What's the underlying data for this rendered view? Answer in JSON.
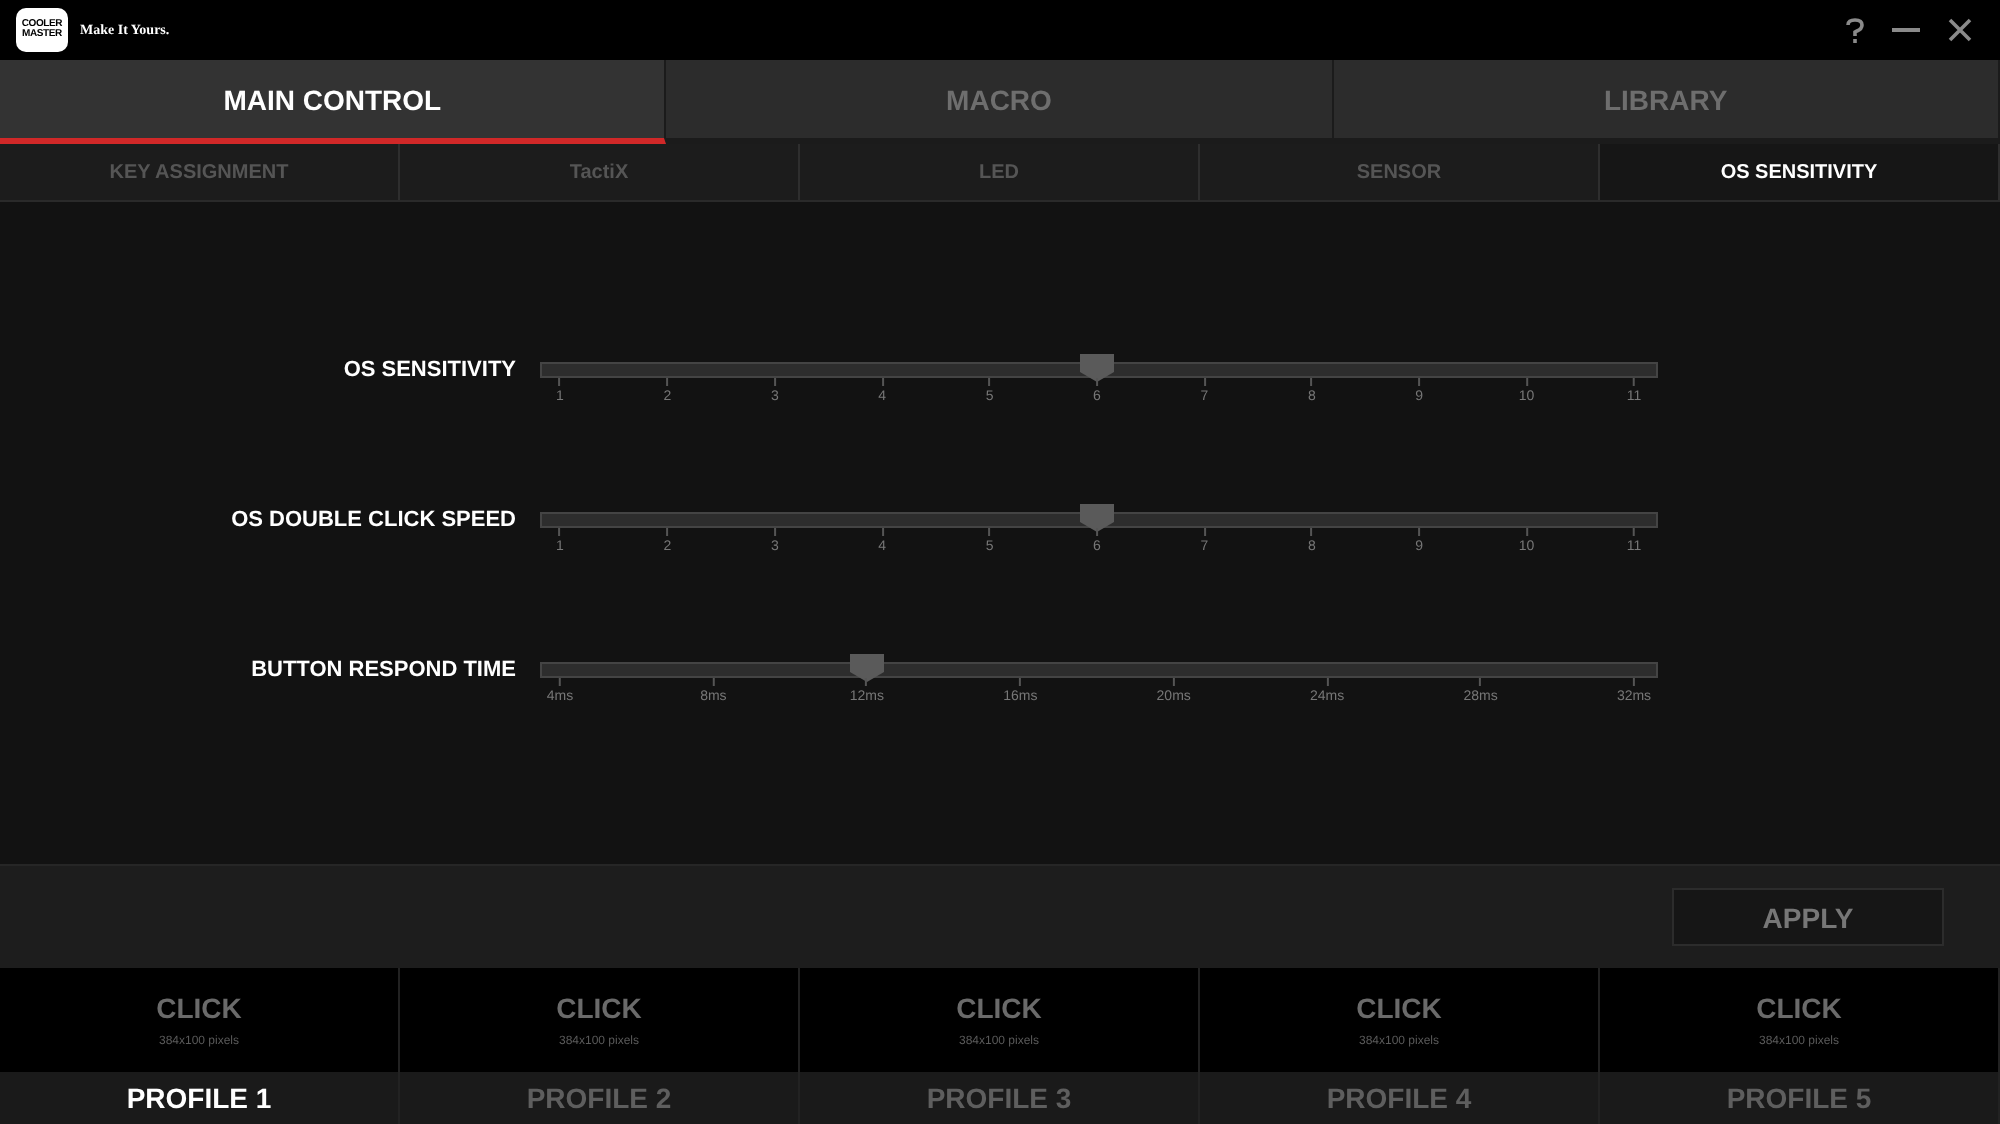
{
  "logo": {
    "lines": [
      "COOLER",
      "MASTER"
    ]
  },
  "tagline": "Make It Yours.",
  "main_tabs": [
    {
      "label": "MAIN CONTROL",
      "selected": true
    },
    {
      "label": "MACRO",
      "selected": false
    },
    {
      "label": "LIBRARY",
      "selected": false
    }
  ],
  "sub_tabs": [
    {
      "label": "KEY ASSIGNMENT",
      "selected": false
    },
    {
      "label": "TactiX",
      "selected": false
    },
    {
      "label": "LED",
      "selected": false
    },
    {
      "label": "SENSOR",
      "selected": false
    },
    {
      "label": "OS SENSITIVITY",
      "selected": true
    }
  ],
  "sliders": [
    {
      "label": "OS SENSITIVITY",
      "level": 0.5,
      "ticks": [
        "1",
        "2",
        "3",
        "4",
        "5",
        "6",
        "7",
        "8",
        "9",
        "10",
        "11"
      ]
    },
    {
      "label": "OS DOUBLE CLICK SPEED",
      "level": 0.5,
      "ticks": [
        "1",
        "2",
        "3",
        "4",
        "5",
        "6",
        "7",
        "8",
        "9",
        "10",
        "11"
      ]
    },
    {
      "label": "BUTTON RESPOND TIME",
      "level": 0.2857,
      "ticks": [
        "4ms",
        "8ms",
        "12ms",
        "16ms",
        "20ms",
        "24ms",
        "28ms",
        "32ms"
      ]
    }
  ],
  "apply_button": "APPLY",
  "profiles": [
    {
      "image_text": "CLICK",
      "image_note": "384x100 pixels",
      "label": "PROFILE 1",
      "selected": true
    },
    {
      "image_text": "CLICK",
      "image_note": "384x100 pixels",
      "label": "PROFILE 2",
      "selected": false
    },
    {
      "image_text": "CLICK",
      "image_note": "384x100 pixels",
      "label": "PROFILE 3",
      "selected": false
    },
    {
      "image_text": "CLICK",
      "image_note": "384x100 pixels",
      "label": "PROFILE 4",
      "selected": false
    },
    {
      "image_text": "CLICK",
      "image_note": "384x100 pixels",
      "label": "PROFILE 5",
      "selected": false
    }
  ]
}
